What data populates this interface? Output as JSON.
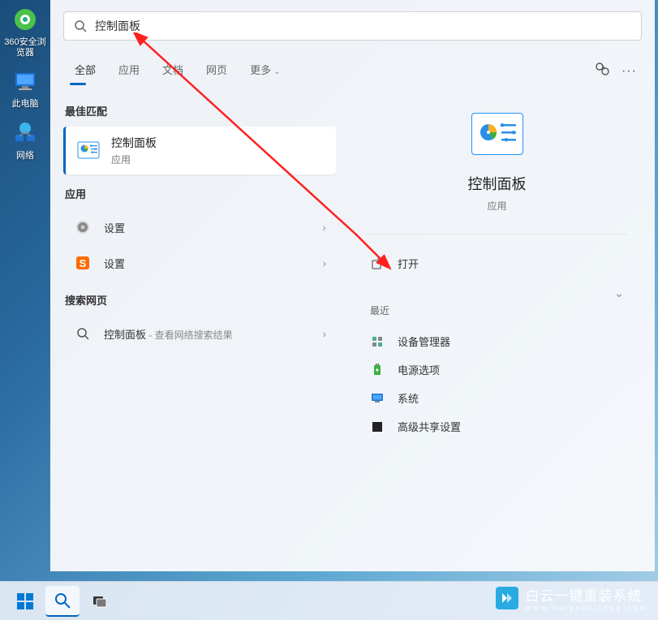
{
  "desktop": {
    "icons": [
      {
        "label": "360安全浏览器"
      },
      {
        "label": "此电脑"
      },
      {
        "label": "网络"
      }
    ]
  },
  "search": {
    "value": "控制面板"
  },
  "tabs": {
    "items": [
      "全部",
      "应用",
      "文档",
      "网页",
      "更多"
    ],
    "active_index": 0
  },
  "results": {
    "best_match_header": "最佳匹配",
    "best_match": {
      "title": "控制面板",
      "subtitle": "应用"
    },
    "apps_header": "应用",
    "apps": [
      {
        "label": "设置",
        "icon": "gear"
      },
      {
        "label": "设置",
        "icon": "sogou"
      }
    ],
    "web_header": "搜索网页",
    "web": {
      "query": "控制面板",
      "suffix": " - 查看网络搜索结果"
    }
  },
  "detail": {
    "title": "控制面板",
    "subtitle": "应用",
    "action_open": "打开",
    "recent_header": "最近",
    "recent": [
      {
        "label": "设备管理器"
      },
      {
        "label": "电源选项"
      },
      {
        "label": "系统"
      },
      {
        "label": "高级共享设置"
      }
    ]
  },
  "watermark": {
    "main": "白云一键重装系统",
    "sub": "www.baiyunxitong.com"
  }
}
